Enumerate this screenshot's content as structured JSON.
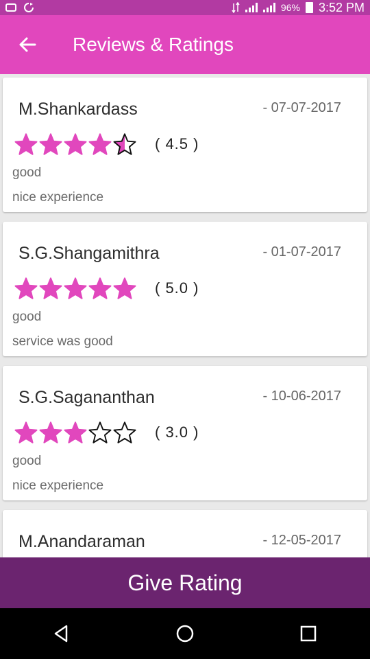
{
  "status_bar": {
    "battery_pct": "96%",
    "time": "3:52 PM",
    "icons": [
      "sim-icon",
      "sync-icon",
      "data-arrows-icon",
      "signal-icon",
      "signal-icon",
      "battery-icon"
    ]
  },
  "app_bar": {
    "back_icon": "arrow-left-icon",
    "title": "Reviews & Ratings"
  },
  "colors": {
    "status_bar": "#b23aa2",
    "app_bar": "#e147bd",
    "star": "#e147bd",
    "button": "#6b246f",
    "nav_bar": "#000000"
  },
  "reviews": [
    {
      "name": "M.Shankardass",
      "date": "- 07-07-2017",
      "rating": 4.5,
      "rating_label": "( 4.5 )",
      "line1": "good",
      "line2": "nice experience"
    },
    {
      "name": "S.G.Shangamithra",
      "date": "- 01-07-2017",
      "rating": 5.0,
      "rating_label": "( 5.0 )",
      "line1": "good",
      "line2": "service was good"
    },
    {
      "name": "S.G.Sagananthan",
      "date": "- 10-06-2017",
      "rating": 3.0,
      "rating_label": "( 3.0 )",
      "line1": "good",
      "line2": "nice experience"
    },
    {
      "name": "M.Anandaraman",
      "date": "- 12-05-2017",
      "rating": null,
      "rating_label": "",
      "line1": "",
      "line2": ""
    }
  ],
  "give_rating": {
    "label": "Give Rating"
  },
  "nav": {
    "back_icon": "triangle-back-icon",
    "home_icon": "circle-home-icon",
    "recents_icon": "square-recents-icon"
  }
}
